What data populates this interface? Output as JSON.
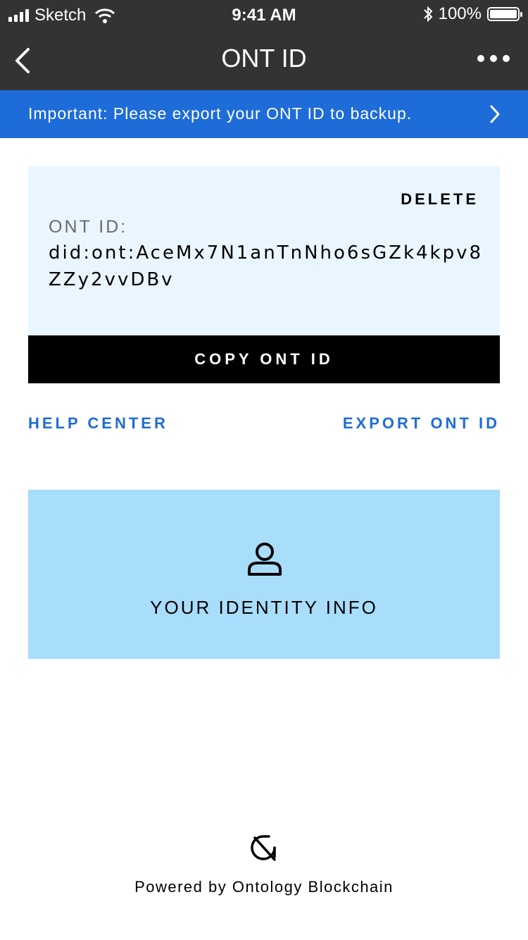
{
  "status_bar": {
    "carrier": "Sketch",
    "time": "9:41 AM",
    "battery_percent": "100%"
  },
  "nav": {
    "title": "ONT ID",
    "back_icon": "chevron-left-icon",
    "more_icon": "ellipsis-icon"
  },
  "banner": {
    "text": "Important: Please export your ONT ID to backup."
  },
  "card": {
    "delete_label": "DELETE",
    "id_label": "ONT ID:",
    "id_value": "did:ont:AceMx7N1anTnNho6sGZk4kpv8ZZy2vvDBv"
  },
  "actions": {
    "copy_label": "COPY ONT ID",
    "help_label": "HELP CENTER",
    "export_label": "EXPORT ONT ID"
  },
  "identity": {
    "label": "YOUR IDENTITY INFO",
    "icon": "user-icon"
  },
  "footer": {
    "text": "Powered by Ontology Blockchain",
    "logo": "ontology-logo-icon"
  },
  "colors": {
    "nav_bg": "#333333",
    "banner_bg": "#1e6cd8",
    "card_bg": "#eaf6ff",
    "identity_bg": "#a9ddfc",
    "link_color": "#1e6cd8"
  }
}
